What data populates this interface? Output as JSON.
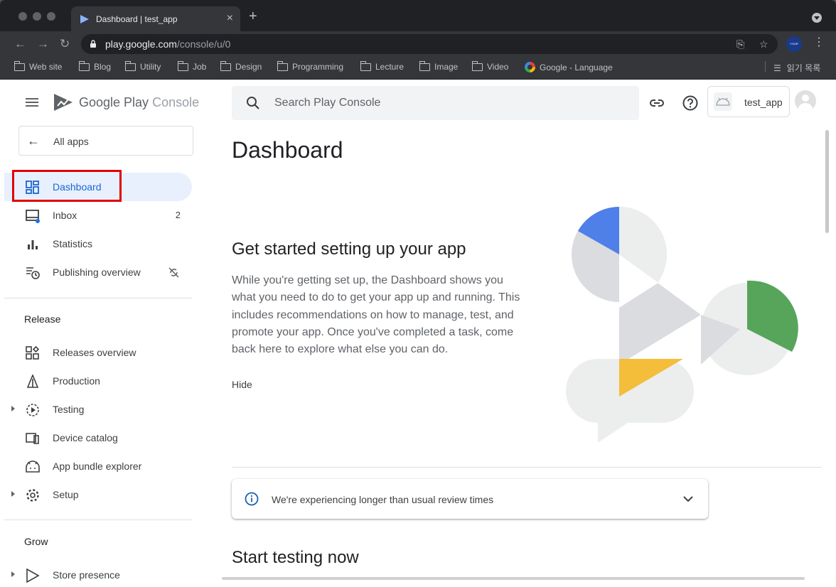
{
  "browser": {
    "tab_title": "Dashboard | test_app",
    "url_host": "play.google.com",
    "url_path": "/console/u/0",
    "bookmarks": [
      "Web site",
      "Blog",
      "Utility",
      "Job",
      "Design",
      "Programming",
      "Lecture",
      "Image",
      "Video",
      "Google - Language"
    ],
    "reading_list": "읽기 목록",
    "profile_initial": "YOUR"
  },
  "sidebar": {
    "logo_text_main": "Google Play",
    "logo_text_sub": " Console",
    "all_apps": "All apps",
    "items": [
      {
        "label": "Dashboard",
        "active": true
      },
      {
        "label": "Inbox",
        "count": "2"
      },
      {
        "label": "Statistics"
      },
      {
        "label": "Publishing overview"
      }
    ],
    "release_header": "Release",
    "release_items": [
      "Releases overview",
      "Production",
      "Testing",
      "Device catalog",
      "App bundle explorer",
      "Setup"
    ],
    "grow_header": "Grow",
    "grow_items": [
      "Store presence"
    ]
  },
  "topbar": {
    "search_placeholder": "Search Play Console",
    "app_name": "test_app"
  },
  "main": {
    "title": "Dashboard",
    "get_started_title": "Get started setting up your app",
    "get_started_body": "While you're getting set up, the Dashboard shows you what you need to do to get your app up and running. This includes recommendations on how to manage, test, and promote your app. Once you've completed a task, come back here to explore what else you can do.",
    "hide_label": "Hide",
    "notice": "We're experiencing longer than usual review times",
    "start_testing_title": "Start testing now"
  },
  "colors": {
    "accent": "#1967d2",
    "active_bg": "#e8f0fe",
    "highlight_border": "#e00000",
    "illus_blue": "#4f7fe8",
    "illus_green": "#57a55a",
    "illus_yellow": "#f4bd3a"
  }
}
